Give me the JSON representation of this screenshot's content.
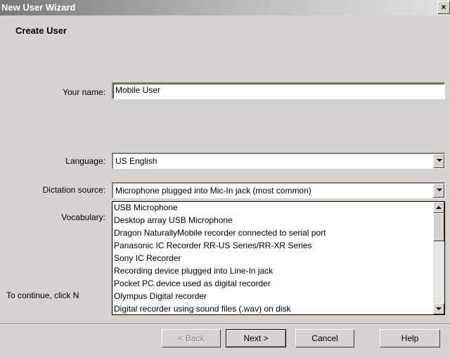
{
  "window": {
    "title": "New User Wizard",
    "close_glyph": "×"
  },
  "page": {
    "heading": "Create User"
  },
  "fields": {
    "name_label": "Your name:",
    "name_value": "Mobile User",
    "language_label": "Language:",
    "language_value": "US English",
    "dictation_label": "Dictation source:",
    "dictation_value": "Microphone plugged into Mic-In jack (most common)",
    "vocabulary_label": "Vocabulary:",
    "continue_text": "To continue, click N"
  },
  "dictation_options": [
    "USB Microphone",
    "Desktop array USB Microphone",
    "Dragon NaturallyMobile recorder connected to serial port",
    "Panasonic IC Recorder RR-US Series/RR-XR Series",
    "Sony IC Recorder",
    "Recording device plugged into Line-In jack",
    "Pocket PC device used as digital recorder",
    "Olympus Digital recorder",
    "Digital recorder using sound files (.wav) on disk"
  ],
  "buttons": {
    "back": "< Back",
    "next": "Next >",
    "cancel": "Cancel",
    "help": "Help"
  },
  "icons": {
    "close": "close-icon",
    "dropdown": "chevron-down-icon",
    "scroll_up": "scroll-up-icon",
    "scroll_down": "scroll-down-icon"
  }
}
